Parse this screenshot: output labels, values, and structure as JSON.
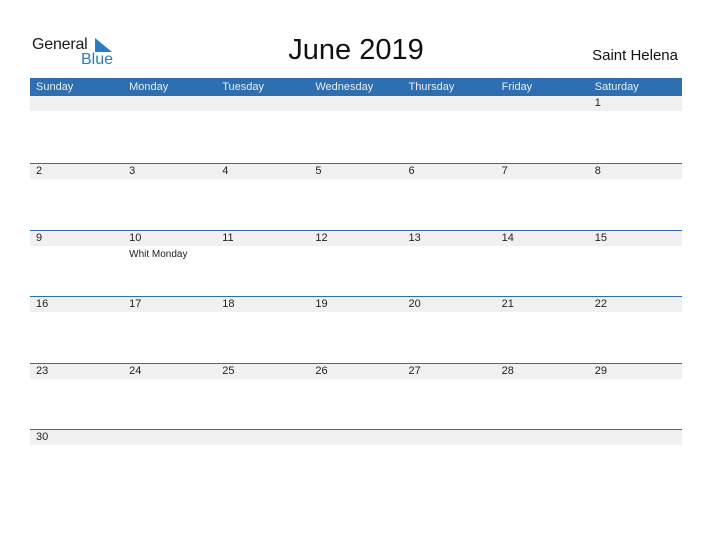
{
  "logo": {
    "general": "General",
    "blue": "Blue"
  },
  "title": "June 2019",
  "country": "Saint Helena",
  "weekdays": [
    "Sunday",
    "Monday",
    "Tuesday",
    "Wednesday",
    "Thursday",
    "Friday",
    "Saturday"
  ],
  "weeks": [
    [
      "",
      "",
      "",
      "",
      "",
      "",
      "1"
    ],
    [
      "2",
      "3",
      "4",
      "5",
      "6",
      "7",
      "8"
    ],
    [
      "9",
      "10",
      "11",
      "12",
      "13",
      "14",
      "15"
    ],
    [
      "16",
      "17",
      "18",
      "19",
      "20",
      "21",
      "22"
    ],
    [
      "23",
      "24",
      "25",
      "26",
      "27",
      "28",
      "29"
    ],
    [
      "30",
      "",
      "",
      "",
      "",
      "",
      ""
    ]
  ],
  "holidays": [
    {
      "week": 2,
      "day": 1,
      "name": "Whit Monday"
    }
  ],
  "colors": {
    "header": "#2d6fb0",
    "accent": "#2a7bc0",
    "day_bar": "#f0f0f0"
  }
}
